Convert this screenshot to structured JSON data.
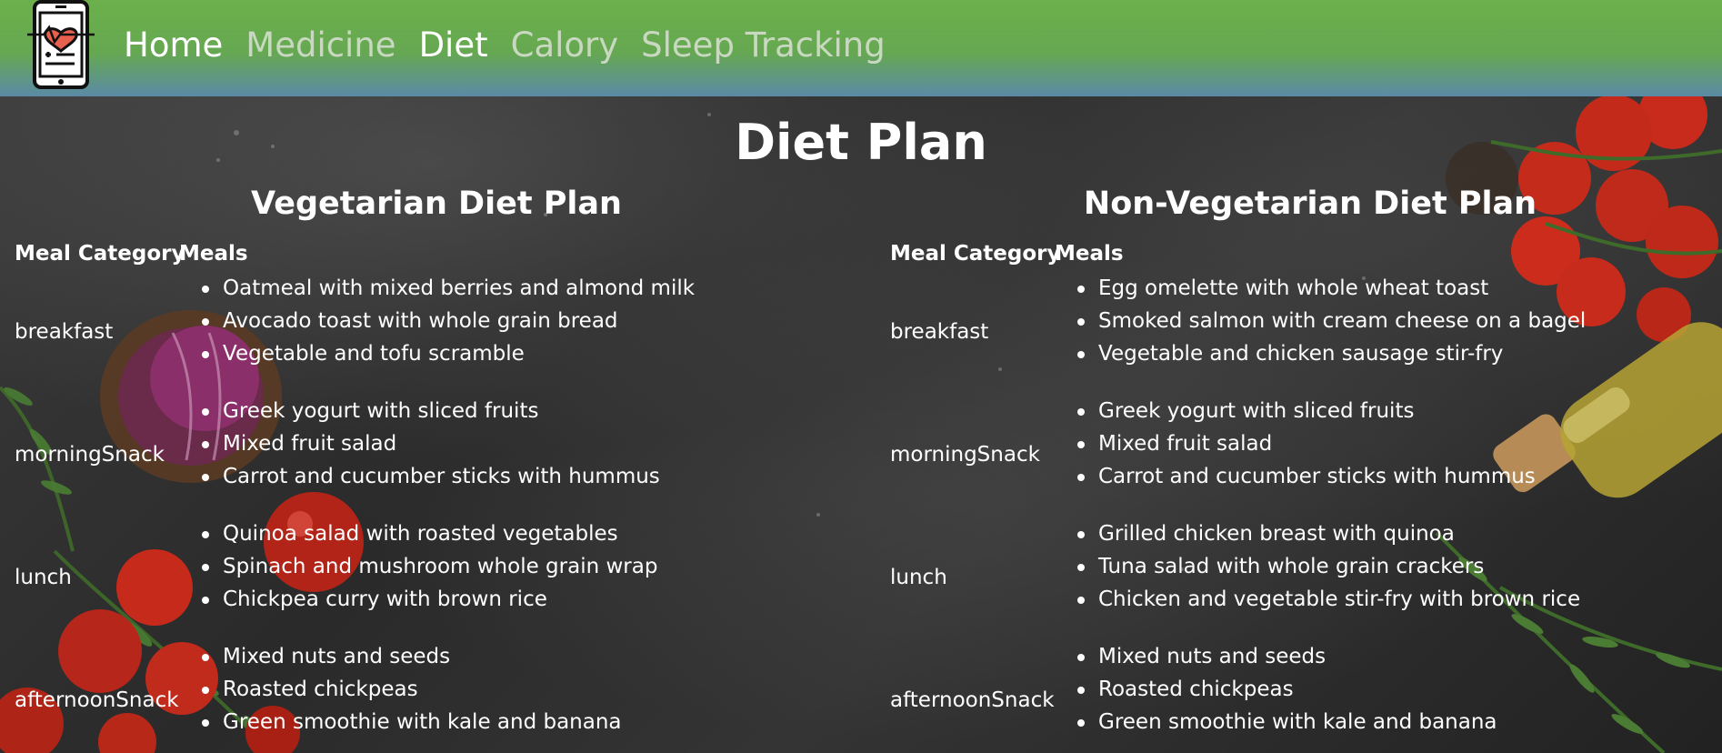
{
  "nav": {
    "logo_icon": "medical-phone-heart-icon",
    "links": [
      {
        "label": "Home",
        "active": true
      },
      {
        "label": "Medicine",
        "active": false
      },
      {
        "label": "Diet",
        "active": true
      },
      {
        "label": "Calory",
        "active": false
      },
      {
        "label": "Sleep Tracking",
        "active": false
      }
    ]
  },
  "colors": {
    "nav_green": "#6bb04b",
    "nav_blue": "#5a8aa6",
    "nav_active_text": "#ffffff",
    "nav_inactive_text": "#c9d8c0",
    "text": "#ffffff"
  },
  "page": {
    "title": "Diet Plan"
  },
  "vegetarian": {
    "title": "Vegetarian Diet Plan",
    "header_category": "Meal Category",
    "header_meals": "Meals",
    "rows": [
      {
        "category": "breakfast",
        "meals": [
          "Oatmeal with mixed berries and almond milk",
          "Avocado toast with whole grain bread",
          "Vegetable and tofu scramble"
        ]
      },
      {
        "category": "morningSnack",
        "meals": [
          "Greek yogurt with sliced fruits",
          "Mixed fruit salad",
          "Carrot and cucumber sticks with hummus"
        ]
      },
      {
        "category": "lunch",
        "meals": [
          "Quinoa salad with roasted vegetables",
          "Spinach and mushroom whole grain wrap",
          "Chickpea curry with brown rice"
        ]
      },
      {
        "category": "afternoonSnack",
        "meals": [
          "Mixed nuts and seeds",
          "Roasted chickpeas",
          "Green smoothie with kale and banana"
        ]
      }
    ]
  },
  "nonvegetarian": {
    "title": "Non-Vegetarian Diet Plan",
    "header_category": "Meal Category",
    "header_meals": "Meals",
    "rows": [
      {
        "category": "breakfast",
        "meals": [
          "Egg omelette with whole wheat toast",
          "Smoked salmon with cream cheese on a bagel",
          "Vegetable and chicken sausage stir-fry"
        ]
      },
      {
        "category": "morningSnack",
        "meals": [
          "Greek yogurt with sliced fruits",
          "Mixed fruit salad",
          "Carrot and cucumber sticks with hummus"
        ]
      },
      {
        "category": "lunch",
        "meals": [
          "Grilled chicken breast with quinoa",
          "Tuna salad with whole grain crackers",
          "Chicken and vegetable stir-fry with brown rice"
        ]
      },
      {
        "category": "afternoonSnack",
        "meals": [
          "Mixed nuts and seeds",
          "Roasted chickpeas",
          "Green smoothie with kale and banana"
        ]
      }
    ]
  }
}
